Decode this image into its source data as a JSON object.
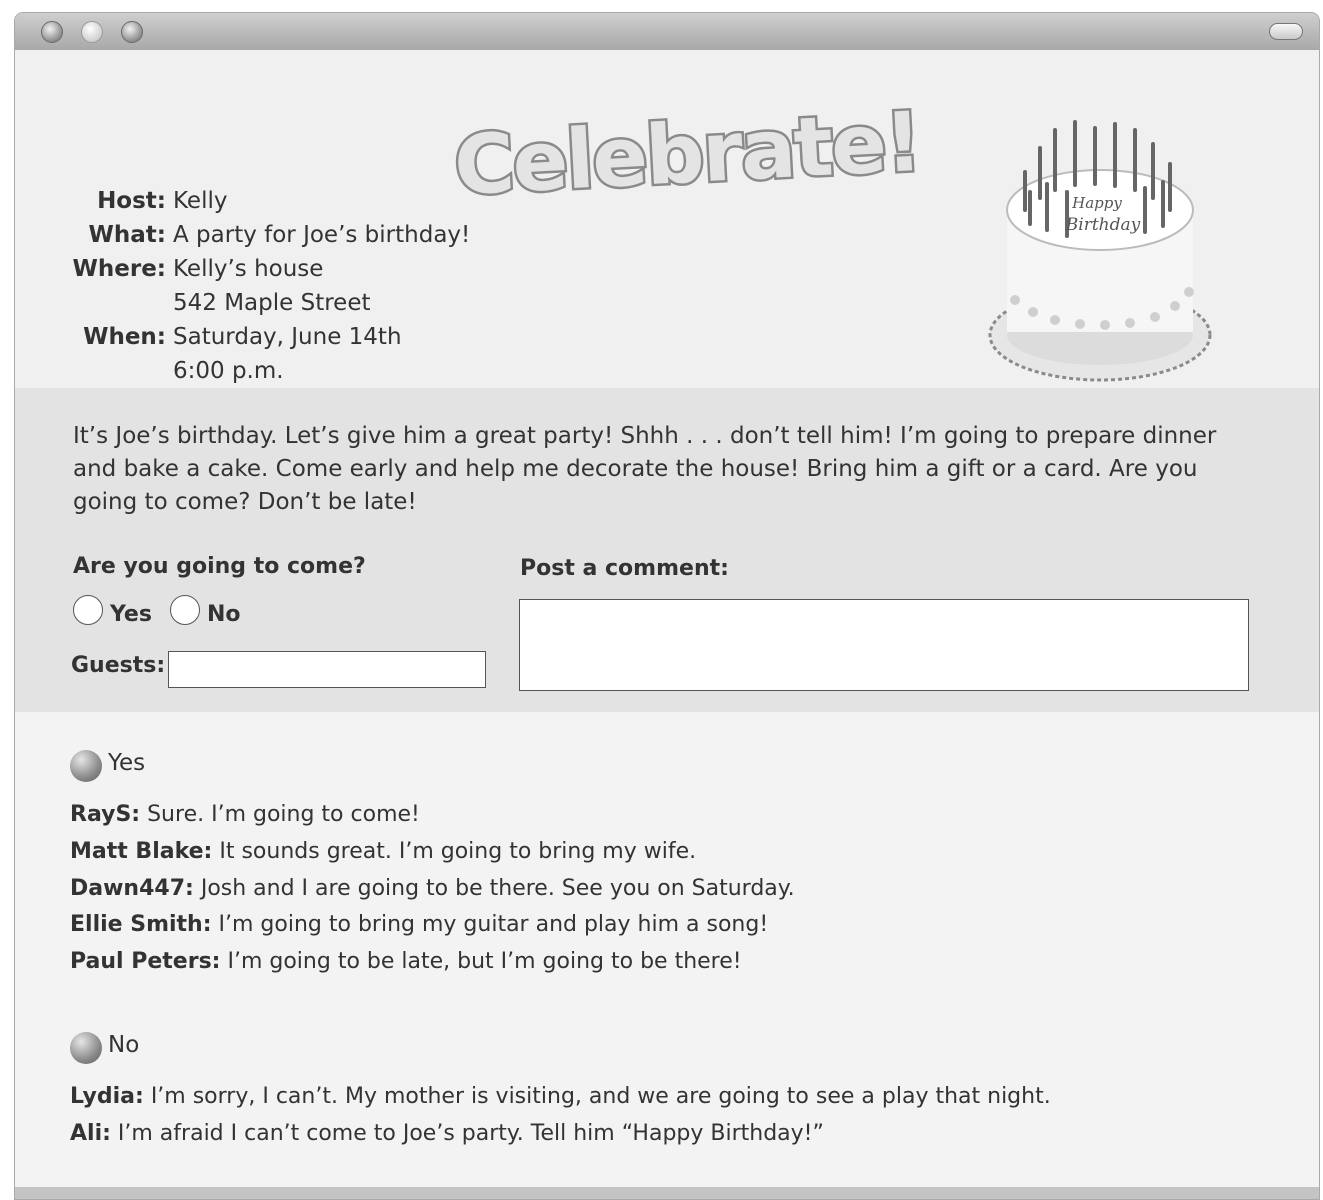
{
  "window": {
    "controls": [
      "close",
      "minimize",
      "zoom"
    ]
  },
  "banner": {
    "title": "Celebrate!",
    "cake_text": [
      "Happy",
      "Birthday"
    ]
  },
  "details": [
    {
      "label": "Host:",
      "value": "Kelly"
    },
    {
      "label": "What:",
      "value": "A party for Joe’s birthday!"
    },
    {
      "label": "Where:",
      "value": "Kelly’s house"
    },
    {
      "label": "",
      "value": "542 Maple Street"
    },
    {
      "label": "When:",
      "value": "Saturday, June 14th"
    },
    {
      "label": "",
      "value": "6:00 p.m."
    }
  ],
  "message": "It’s Joe’s birthday. Let’s give him a great party! Shhh . . . don’t tell him! I’m going to prepare dinner and bake a cake. Come early and help me decorate the house! Bring him a gift or a card. Are you going to come? Don’t be late!",
  "form": {
    "rsvp_label": "Are you going to come?",
    "yes_label": "Yes",
    "no_label": "No",
    "guests_label": "Guests:",
    "guests_value": "",
    "comment_label": "Post a comment:",
    "comment_value": ""
  },
  "responses": {
    "yes": {
      "title": "Yes",
      "comments": [
        {
          "name": "RayS:",
          "text": "Sure. I’m going to come!"
        },
        {
          "name": "Matt Blake:",
          "text": "It sounds great. I’m going to bring my wife."
        },
        {
          "name": "Dawn447:",
          "text": "Josh and I are going to be there. See you on Saturday."
        },
        {
          "name": "Ellie Smith:",
          "text": "I’m going to bring my guitar and play him a song!"
        },
        {
          "name": "Paul Peters:",
          "text": "I’m going to be late, but I’m going to be there!"
        }
      ]
    },
    "no": {
      "title": "No",
      "comments": [
        {
          "name": "Lydia:",
          "text": "I’m sorry, I can’t. My mother is visiting, and we are going to see a play that night."
        },
        {
          "name": "Ali:",
          "text": "I’m afraid I can’t come to Joe’s party. Tell him “Happy Birthday!”"
        }
      ]
    }
  }
}
